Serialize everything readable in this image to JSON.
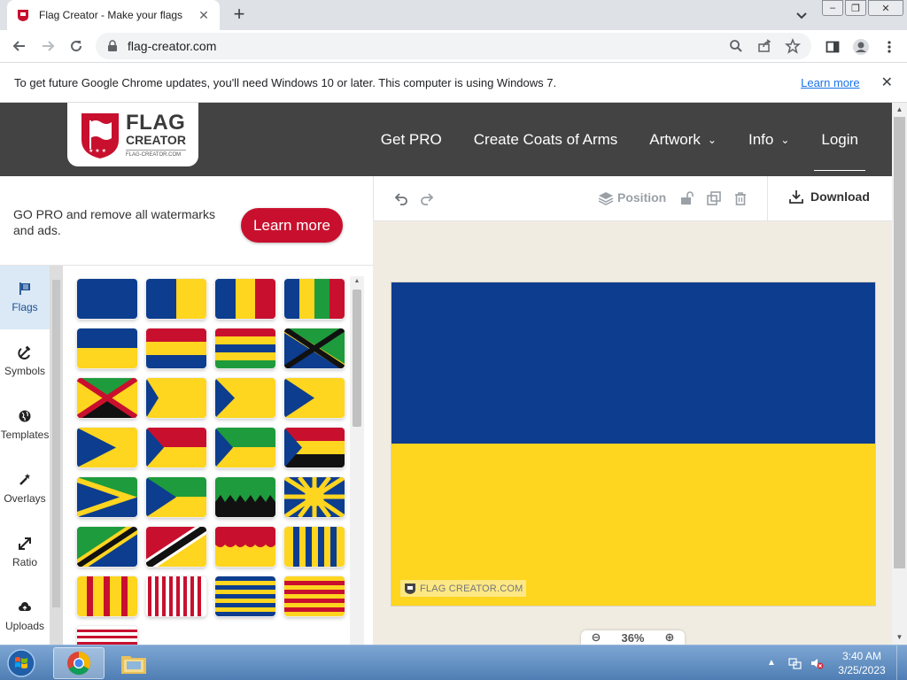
{
  "browser": {
    "tab_title": "Flag Creator - Make your flags",
    "url": "flag-creator.com",
    "info_message": "To get future Google Chrome updates, you'll need Windows 10 or later. This computer is using Windows 7.",
    "info_link": "Learn more"
  },
  "site": {
    "logo_line1": "FLAG",
    "logo_line2": "CREATOR",
    "logo_line3": "FLAG-CREATOR.COM",
    "nav": [
      {
        "label": "Get PRO"
      },
      {
        "label": "Create Coats of Arms"
      },
      {
        "label": "Artwork"
      },
      {
        "label": "Info"
      },
      {
        "label": "Login"
      }
    ]
  },
  "promo": {
    "text": "GO PRO and remove all watermarks and ads.",
    "button": "Learn more"
  },
  "sidebar": {
    "items": [
      {
        "label": "Flags",
        "icon": "flag-icon"
      },
      {
        "label": "Symbols",
        "icon": "hammer-sickle-icon"
      },
      {
        "label": "Templates",
        "icon": "globe-icon"
      },
      {
        "label": "Overlays",
        "icon": "magic-wand-icon"
      },
      {
        "label": "Ratio",
        "icon": "resize-arrow-icon"
      },
      {
        "label": "Uploads",
        "icon": "upload-cloud-icon"
      }
    ]
  },
  "editor": {
    "position_label": "Position",
    "download_label": "Download",
    "zoom": "36%",
    "watermark": "FLAG CREATOR.COM"
  },
  "colors": {
    "flag_blue": "#0c3d8f",
    "flag_yellow": "#fed51f",
    "accent_red": "#c8102e",
    "header_bg": "#434343"
  },
  "taskbar": {
    "time": "3:40 AM",
    "date": "3/25/2023"
  }
}
